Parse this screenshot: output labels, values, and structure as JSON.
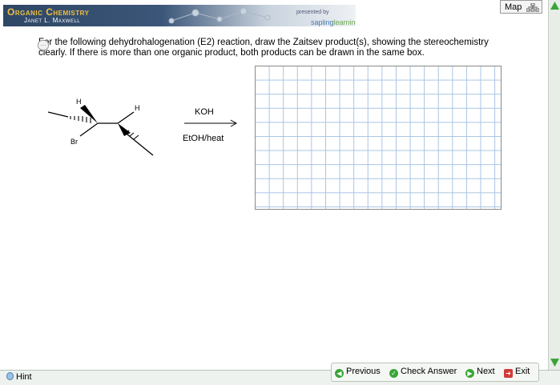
{
  "header": {
    "course_title": "Organic Chemistry",
    "author": "Janet L. Maxwell",
    "presented_by": "presented by",
    "publisher_part1": "sapling",
    "publisher_part2": "learning",
    "map_label": "Map"
  },
  "question": {
    "text": "For the following dehydrohalogenation (E2) reaction, draw the Zaitsev product(s), showing the stereochemistry clearly. If there is more than one organic product, both products can be drawn in the same box."
  },
  "reaction": {
    "reagent_top": "KOH",
    "reagent_bottom": "EtOH/heat",
    "atom_labels": {
      "h1": "H",
      "h2": "H",
      "br": "Br"
    }
  },
  "footer": {
    "hint": "Hint",
    "previous": "Previous",
    "check_answer": "Check Answer",
    "next": "Next",
    "exit": "Exit"
  },
  "colors": {
    "accent_green": "#3aa43a",
    "banner_blue": "#2f4766",
    "gold": "#f0c040",
    "grid_blue": "#a7c4e3"
  }
}
